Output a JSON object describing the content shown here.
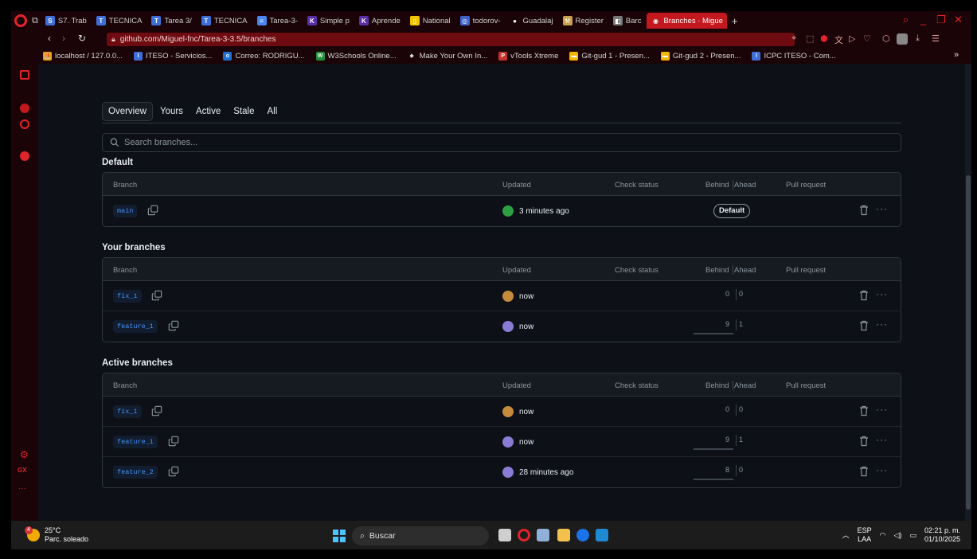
{
  "browser": {
    "tabs": [
      {
        "label": "S7. Trab",
        "color": "#3d6fd8",
        "glyph": "S"
      },
      {
        "label": "TECNICA",
        "color": "#3d6fd8",
        "glyph": "T"
      },
      {
        "label": "Tarea 3/",
        "color": "#3d6fd8",
        "glyph": "T"
      },
      {
        "label": "TECNICA",
        "color": "#3d6fd8",
        "glyph": "T"
      },
      {
        "label": "Tarea-3-",
        "color": "#4a86f0",
        "glyph": "≡"
      },
      {
        "label": "Simple p",
        "color": "#5a2ea6",
        "glyph": "K"
      },
      {
        "label": "Aprende",
        "color": "#5a2ea6",
        "glyph": "K"
      },
      {
        "label": "National",
        "color": "#f5c400",
        "glyph": "▯"
      },
      {
        "label": "todorov-",
        "color": "#3f63c8",
        "glyph": "◎"
      },
      {
        "label": "Guadalaj",
        "color": "#ffffff",
        "glyph": "●"
      },
      {
        "label": "Register",
        "color": "#caa24d",
        "glyph": "⚒"
      },
      {
        "label": "Barc",
        "color": "#777777",
        "glyph": "◧"
      },
      {
        "label": "Branches · Migue",
        "color": "#ffffff",
        "glyph": "◉"
      }
    ],
    "url": "github.com/Miguel-fnc/Tarea-3-3.5/branches",
    "bookmarks": [
      {
        "label": "localhost / 127.0.0...",
        "color": "#e8a320",
        "glyph": "⛵"
      },
      {
        "label": "ITESO - Servicios...",
        "color": "#3d6fd8",
        "glyph": "I"
      },
      {
        "label": "Correo: RODRIGU...",
        "color": "#1f6fd0",
        "glyph": "o"
      },
      {
        "label": "W3Schools Online...",
        "color": "#1f8f3a",
        "glyph": "W"
      },
      {
        "label": "Make Your Own In...",
        "color": "#dddddd",
        "glyph": "◆"
      },
      {
        "label": "vTools Xtreme",
        "color": "#c2332f",
        "glyph": "P"
      },
      {
        "label": "Git-gud 1 - Presen...",
        "color": "#f5b400",
        "glyph": "▬"
      },
      {
        "label": "Git-gud 2 - Presen...",
        "color": "#f5b400",
        "glyph": "▬"
      },
      {
        "label": "ICPC ITESO - Com...",
        "color": "#3d6fd8",
        "glyph": "I"
      }
    ]
  },
  "page": {
    "tabs": [
      "Overview",
      "Yours",
      "Active",
      "Stale",
      "All"
    ],
    "search_placeholder": "Search branches...",
    "columns": {
      "branch": "Branch",
      "updated": "Updated",
      "check": "Check status",
      "behind": "Behind",
      "ahead": "Ahead",
      "pr": "Pull request"
    },
    "sections": [
      {
        "title": "Default",
        "rows": [
          {
            "name": "main",
            "updated": "3 minutes ago",
            "avatar": "#2ea043",
            "default": true,
            "default_label": "Default"
          }
        ]
      },
      {
        "title": "Your branches",
        "rows": [
          {
            "name": "fix_1",
            "updated": "now",
            "avatar": "#c58a3c",
            "behind": "0",
            "ahead": "0"
          },
          {
            "name": "feature_1",
            "updated": "now",
            "avatar": "#8a7bd4",
            "behind": "9",
            "ahead": "1"
          }
        ]
      },
      {
        "title": "Active branches",
        "rows": [
          {
            "name": "fix_1",
            "updated": "now",
            "avatar": "#c58a3c",
            "behind": "0",
            "ahead": "0"
          },
          {
            "name": "feature_1",
            "updated": "now",
            "avatar": "#8a7bd4",
            "behind": "9",
            "ahead": "1"
          },
          {
            "name": "feature_2",
            "updated": "28 minutes ago",
            "avatar": "#8a7bd4",
            "behind": "8",
            "ahead": "0"
          }
        ]
      }
    ]
  },
  "taskbar": {
    "weather_temp": "25°C",
    "weather_desc": "Parc. soleado",
    "weather_badge": "4",
    "search_label": "Buscar",
    "lang_1": "ESP",
    "lang_2": "LAA",
    "time": "02:21 p. m.",
    "date": "01/10/2025"
  },
  "colors": {
    "accent": "#c4181f",
    "link": "#4493f8",
    "background": "#0d1117",
    "border": "#30363d"
  }
}
